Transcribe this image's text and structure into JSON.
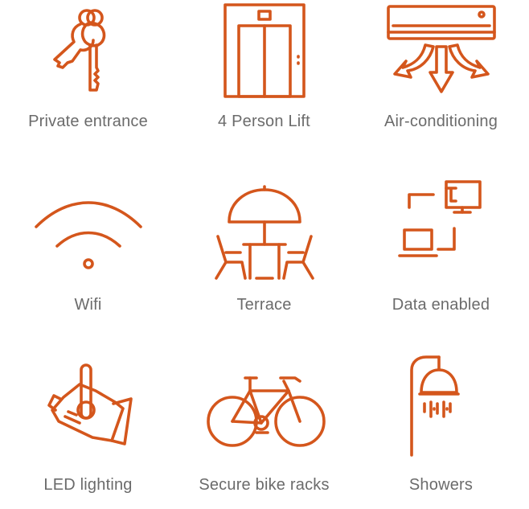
{
  "colors": {
    "accent": "#D4561C",
    "label": "#6b6b6b"
  },
  "amenities": [
    {
      "label": "Private entrance",
      "icon": "keys-icon"
    },
    {
      "label": "4 Person Lift",
      "icon": "lift-icon"
    },
    {
      "label": "Air-conditioning",
      "icon": "air-conditioner-icon"
    },
    {
      "label": "Wifi",
      "icon": "wifi-icon"
    },
    {
      "label": "Terrace",
      "icon": "terrace-icon"
    },
    {
      "label": "Data enabled",
      "icon": "data-network-icon"
    },
    {
      "label": "LED lighting",
      "icon": "spotlight-icon"
    },
    {
      "label": "Secure bike racks",
      "icon": "bicycle-icon"
    },
    {
      "label": "Showers",
      "icon": "shower-icon"
    }
  ]
}
